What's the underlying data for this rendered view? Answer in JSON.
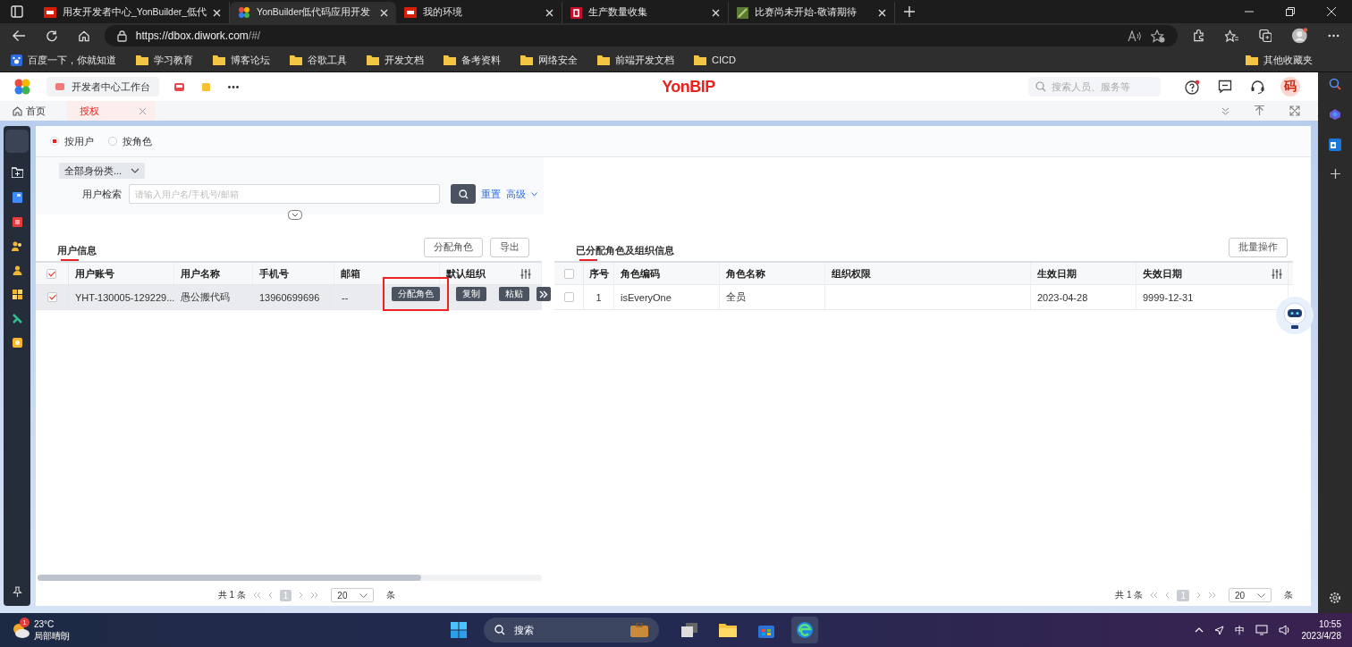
{
  "browser": {
    "tabs": [
      {
        "title": "用友开发者中心_YonBuilder_低代",
        "selected": false
      },
      {
        "title": "YonBuilder低代码应用开发",
        "selected": true
      },
      {
        "title": "我的环境",
        "selected": false
      },
      {
        "title": "生产数量收集",
        "selected": false
      },
      {
        "title": "比赛尚未开始-敬请期待",
        "selected": false
      }
    ],
    "address_host": "https://dbox.diwork.com",
    "address_path": "/#/",
    "bookmarks": [
      {
        "label": "百度一下，你就知道",
        "kind": "site"
      },
      {
        "label": "学习教育",
        "kind": "folder"
      },
      {
        "label": "博客论坛",
        "kind": "folder"
      },
      {
        "label": "谷歌工具",
        "kind": "folder"
      },
      {
        "label": "开发文档",
        "kind": "folder"
      },
      {
        "label": "备考资料",
        "kind": "folder"
      },
      {
        "label": "网络安全",
        "kind": "folder"
      },
      {
        "label": "前端开发文档",
        "kind": "folder"
      },
      {
        "label": "CICD",
        "kind": "folder"
      }
    ],
    "other_bookmarks": "其他收藏夹"
  },
  "app": {
    "logo": "YonBIP",
    "workbench": "开发者中心工作台",
    "search_placeholder": "搜索人员、服务等",
    "avatar": "码",
    "page_tabs": [
      {
        "label": "首页",
        "selected": false,
        "closable": false
      },
      {
        "label": "授权",
        "selected": true,
        "closable": true
      }
    ],
    "modes": [
      {
        "label": "按用户",
        "selected": true
      },
      {
        "label": "按角色",
        "selected": false
      }
    ],
    "filter": {
      "identity": "全部身份类...",
      "search_label": "用户检索",
      "search_placeholder": "请输入用户名/手机号/邮箱",
      "reset": "重置",
      "advanced": "高级"
    },
    "users": {
      "title": "用户信息",
      "buttons": [
        "分配角色",
        "导出"
      ],
      "all_checked": true,
      "columns": [
        "用户账号",
        "用户名称",
        "手机号",
        "邮箱",
        "默认组织"
      ],
      "rows": [
        {
          "checked": true,
          "cells": [
            "YHT-130005-129229...",
            "愚公搬代码",
            "13960699696",
            "--"
          ]
        }
      ],
      "row_actions": [
        {
          "label": "分配角色",
          "highlighted": true
        },
        {
          "label": "复制",
          "highlighted": false
        },
        {
          "label": "粘贴",
          "highlighted": false
        }
      ],
      "pager": {
        "total": "共 1 条",
        "page": "1",
        "size": "20",
        "unit": "条"
      }
    },
    "roles": {
      "title": "已分配角色及组织信息",
      "button": "批量操作",
      "all_checked": false,
      "columns": [
        "序号",
        "角色编码",
        "角色名称",
        "组织权限",
        "生效日期",
        "失效日期"
      ],
      "rows": [
        {
          "checked": false,
          "cells": [
            "1",
            "isEveryOne",
            "全员",
            "",
            "2023-04-28",
            "9999-12-31"
          ]
        }
      ],
      "pager": {
        "total": "共 1 条",
        "page": "1",
        "size": "20",
        "unit": "条"
      }
    }
  },
  "taskbar": {
    "temperature": "23°C",
    "weather": "局部晴朗",
    "weather_badge": "1",
    "search": "搜索",
    "ime": "中",
    "time": "10:55",
    "date": "2023/4/28"
  }
}
